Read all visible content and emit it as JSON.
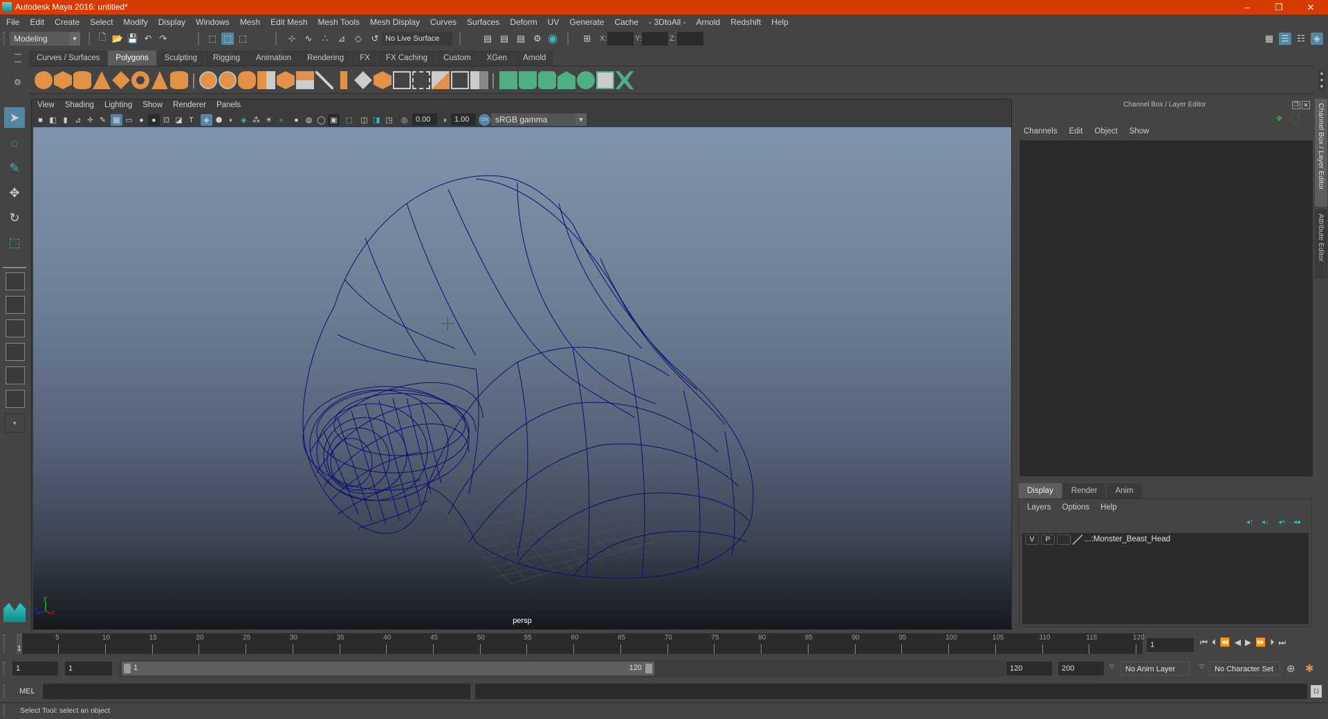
{
  "window": {
    "title": "Autodesk Maya 2016: untitled*",
    "controls": {
      "minimize": "–",
      "restore": "❐",
      "close": "✕"
    }
  },
  "menubar": [
    "File",
    "Edit",
    "Create",
    "Select",
    "Modify",
    "Display",
    "Windows",
    "Mesh",
    "Edit Mesh",
    "Mesh Tools",
    "Mesh Display",
    "Curves",
    "Surfaces",
    "Deform",
    "UV",
    "Generate",
    "Cache",
    "- 3DtoAll -",
    "Arnold",
    "Redshift",
    "Help"
  ],
  "statusline": {
    "mode": "Modeling",
    "live_surface": "No Live Surface",
    "xyz_labels": [
      "X:",
      "Y:",
      "Z:"
    ],
    "xyz_values": [
      "",
      "",
      ""
    ]
  },
  "shelf": {
    "tabs": [
      "Curves / Surfaces",
      "Polygons",
      "Sculpting",
      "Rigging",
      "Animation",
      "Rendering",
      "FX",
      "FX Caching",
      "Custom",
      "XGen",
      "Arnold"
    ],
    "active_tab": "Polygons",
    "poly_icons": [
      "sphere",
      "cube",
      "cylinder",
      "cone",
      "plane",
      "torus",
      "pyramid",
      "pipe"
    ],
    "tool_icons": [
      "combine",
      "separate",
      "mirror",
      "smooth",
      "extract",
      "bevel",
      "multi-cut",
      "bridge",
      "fill-hole",
      "extrude",
      "append",
      "insert-edge-loop",
      "triangulate",
      "quadrangulate",
      "merge"
    ],
    "uv_icons": [
      "planar-uv",
      "cylindrical-uv",
      "spherical-uv",
      "auto-uv",
      "unfold-uv",
      "uv-editor",
      "cut-uv"
    ]
  },
  "toolbox": {
    "tools": [
      "select-tool",
      "lasso-tool",
      "paint-select-tool",
      "move-tool",
      "rotate-tool",
      "scale-tool"
    ],
    "active_tool": "select-tool",
    "layouts": [
      "single-perspective",
      "four-view",
      "persp-outliner",
      "persp-graph",
      "hypershade-persp",
      "persp-graph-hypergraph"
    ]
  },
  "panel": {
    "menu": [
      "View",
      "Shading",
      "Lighting",
      "Show",
      "Renderer",
      "Panels"
    ],
    "exposure": "0.00",
    "gamma": "1.00",
    "color_space": "sRGB gamma",
    "camera_label": "persp",
    "axis": {
      "x": "x",
      "y": "y",
      "z": "z"
    }
  },
  "rightpanel": {
    "title": "Channel Box / Layer Editor",
    "menu": [
      "Channels",
      "Edit",
      "Object",
      "Show"
    ],
    "layer_tabs": [
      "Display",
      "Render",
      "Anim"
    ],
    "active_layer_tab": "Display",
    "layer_menu": [
      "Layers",
      "Options",
      "Help"
    ],
    "layers": [
      {
        "visible": "V",
        "playback": "P",
        "name": "...:Monster_Beast_Head"
      }
    ],
    "side_tabs": [
      "Channel Box / Layer Editor",
      "Attribute Editor"
    ]
  },
  "timeline": {
    "start": 1,
    "end": 120,
    "ticks": [
      5,
      10,
      15,
      20,
      25,
      30,
      35,
      40,
      45,
      50,
      55,
      60,
      65,
      70,
      75,
      80,
      85,
      90,
      95,
      100,
      105,
      110,
      115,
      120
    ],
    "current_frame": "1",
    "current_marker": "1"
  },
  "range": {
    "start_time": "1",
    "playback_start": "1",
    "range_start_label": "1",
    "range_end_label": "120",
    "playback_end": "120",
    "end_time": "200",
    "anim_layer": "No Anim Layer",
    "character_set": "No Character Set"
  },
  "cmdline": {
    "label": "MEL",
    "value": "",
    "result": ""
  },
  "helpline": {
    "text": "Select Tool: select an object"
  },
  "colors": {
    "titlebar": "#d83b01",
    "accent": "#5285a6",
    "wireframe": "#0a0f6e",
    "shelf_poly": "#e29146",
    "shelf_uv": "#4fae84"
  }
}
